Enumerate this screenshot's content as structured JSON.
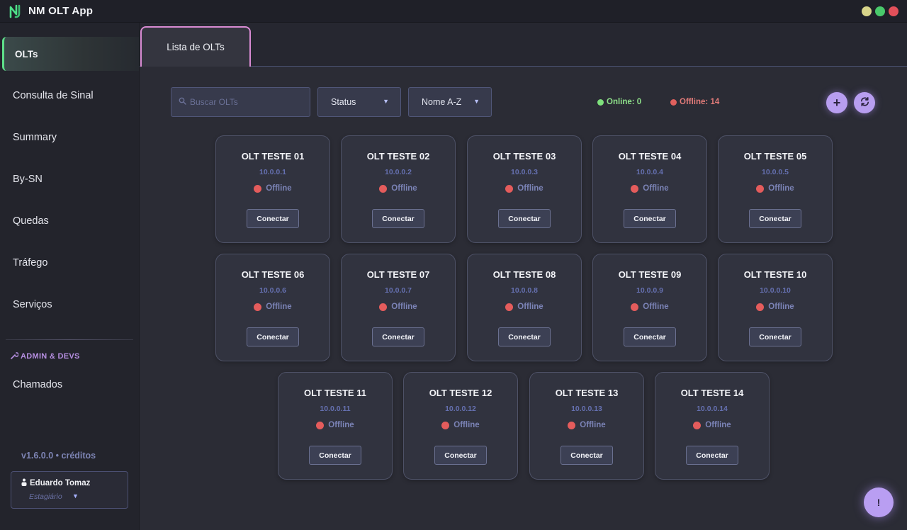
{
  "app": {
    "title": "NM OLT App"
  },
  "colors": {
    "accent": "#b89ef0",
    "online": "#7ee07c",
    "offline": "#e45c5c",
    "active_tab_border": "#d98bd3"
  },
  "sidebar": {
    "items": [
      {
        "label": "OLTs",
        "active": true
      },
      {
        "label": "Consulta de Sinal"
      },
      {
        "label": "Summary"
      },
      {
        "label": "By-SN"
      },
      {
        "label": "Quedas"
      },
      {
        "label": "Tráfego"
      },
      {
        "label": "Serviços"
      }
    ],
    "admin_section_label": "ADMIN & DEVS",
    "admin_items": [
      {
        "label": "Chamados"
      }
    ],
    "version": "v1.6.0.0 • créditos",
    "user": {
      "name": "Eduardo Tomaz",
      "role": "Estagiário"
    }
  },
  "tabs": [
    {
      "label": "Lista de OLTs",
      "active": true
    }
  ],
  "toolbar": {
    "search_placeholder": "Buscar OLTs",
    "status_filter": "Status",
    "sort": "Nome A-Z",
    "online_label": "Online: 0",
    "offline_label": "Offline: 14",
    "add_symbol": "+",
    "refresh_symbol": "⟳"
  },
  "olts": [
    {
      "name": "OLT TESTE 01",
      "ip": "10.0.0.1",
      "status": "Offline"
    },
    {
      "name": "OLT TESTE 02",
      "ip": "10.0.0.2",
      "status": "Offline"
    },
    {
      "name": "OLT TESTE 03",
      "ip": "10.0.0.3",
      "status": "Offline"
    },
    {
      "name": "OLT TESTE 04",
      "ip": "10.0.0.4",
      "status": "Offline"
    },
    {
      "name": "OLT TESTE 05",
      "ip": "10.0.0.5",
      "status": "Offline"
    },
    {
      "name": "OLT TESTE 06",
      "ip": "10.0.0.6",
      "status": "Offline"
    },
    {
      "name": "OLT TESTE 07",
      "ip": "10.0.0.7",
      "status": "Offline"
    },
    {
      "name": "OLT TESTE 08",
      "ip": "10.0.0.8",
      "status": "Offline"
    },
    {
      "name": "OLT TESTE 09",
      "ip": "10.0.0.9",
      "status": "Offline"
    },
    {
      "name": "OLT TESTE 10",
      "ip": "10.0.0.10",
      "status": "Offline"
    },
    {
      "name": "OLT TESTE 11",
      "ip": "10.0.0.11",
      "status": "Offline"
    },
    {
      "name": "OLT TESTE 12",
      "ip": "10.0.0.12",
      "status": "Offline"
    },
    {
      "name": "OLT TESTE 13",
      "ip": "10.0.0.13",
      "status": "Offline"
    },
    {
      "name": "OLT TESTE 14",
      "ip": "10.0.0.14",
      "status": "Offline"
    }
  ],
  "card_button_label": "Conectar",
  "help_symbol": "!"
}
